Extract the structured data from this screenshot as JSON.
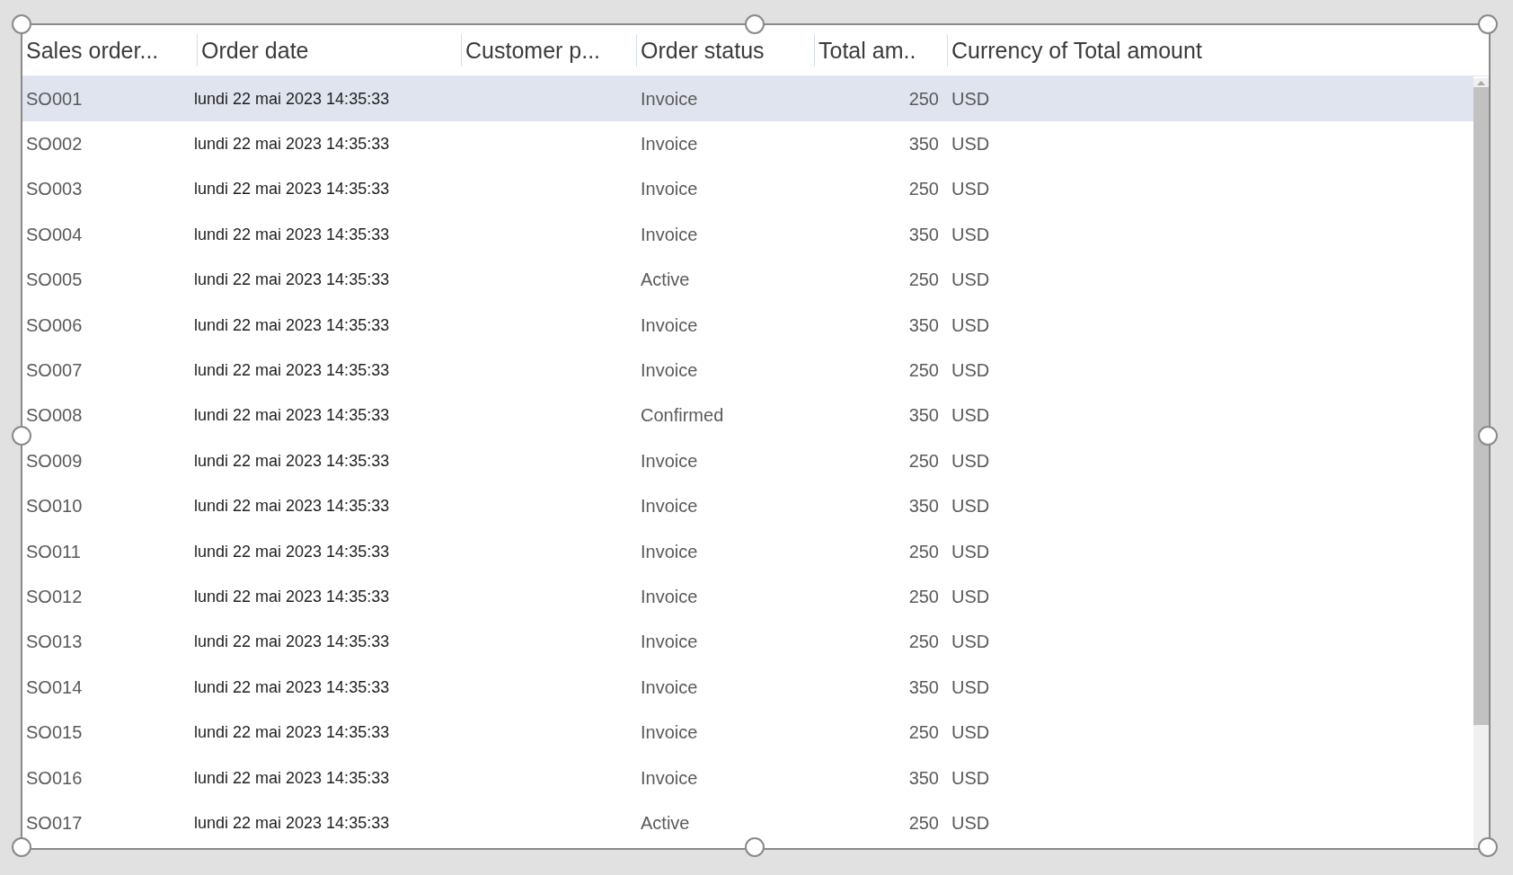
{
  "table": {
    "columns": [
      "Sales order...",
      "Order date",
      "Customer p...",
      "Order status",
      "Total am..",
      "Currency of Total amount"
    ],
    "rows": [
      {
        "order": "SO001",
        "date": "lundi 22 mai 2023 14:35:33",
        "status": "Invoice",
        "total": "250",
        "currency": "USD",
        "selected": true
      },
      {
        "order": "SO002",
        "date": "lundi 22 mai 2023 14:35:33",
        "status": "Invoice",
        "total": "350",
        "currency": "USD",
        "selected": false
      },
      {
        "order": "SO003",
        "date": "lundi 22 mai 2023 14:35:33",
        "status": "Invoice",
        "total": "250",
        "currency": "USD",
        "selected": false
      },
      {
        "order": "SO004",
        "date": "lundi 22 mai 2023 14:35:33",
        "status": "Invoice",
        "total": "350",
        "currency": "USD",
        "selected": false
      },
      {
        "order": "SO005",
        "date": "lundi 22 mai 2023 14:35:33",
        "status": "Active",
        "total": "250",
        "currency": "USD",
        "selected": false
      },
      {
        "order": "SO006",
        "date": "lundi 22 mai 2023 14:35:33",
        "status": "Invoice",
        "total": "350",
        "currency": "USD",
        "selected": false
      },
      {
        "order": "SO007",
        "date": "lundi 22 mai 2023 14:35:33",
        "status": "Invoice",
        "total": "250",
        "currency": "USD",
        "selected": false
      },
      {
        "order": "SO008",
        "date": "lundi 22 mai 2023 14:35:33",
        "status": "Confirmed",
        "total": "350",
        "currency": "USD",
        "selected": false
      },
      {
        "order": "SO009",
        "date": "lundi 22 mai 2023 14:35:33",
        "status": "Invoice",
        "total": "250",
        "currency": "USD",
        "selected": false
      },
      {
        "order": "SO010",
        "date": "lundi 22 mai 2023 14:35:33",
        "status": "Invoice",
        "total": "350",
        "currency": "USD",
        "selected": false
      },
      {
        "order": "SO011",
        "date": "lundi 22 mai 2023 14:35:33",
        "status": "Invoice",
        "total": "250",
        "currency": "USD",
        "selected": false
      },
      {
        "order": "SO012",
        "date": "lundi 22 mai 2023 14:35:33",
        "status": "Invoice",
        "total": "250",
        "currency": "USD",
        "selected": false
      },
      {
        "order": "SO013",
        "date": "lundi 22 mai 2023 14:35:33",
        "status": "Invoice",
        "total": "250",
        "currency": "USD",
        "selected": false
      },
      {
        "order": "SO014",
        "date": "lundi 22 mai 2023 14:35:33",
        "status": "Invoice",
        "total": "350",
        "currency": "USD",
        "selected": false
      },
      {
        "order": "SO015",
        "date": "lundi 22 mai 2023 14:35:33",
        "status": "Invoice",
        "total": "250",
        "currency": "USD",
        "selected": false
      },
      {
        "order": "SO016",
        "date": "lundi 22 mai 2023 14:35:33",
        "status": "Invoice",
        "total": "350",
        "currency": "USD",
        "selected": false
      },
      {
        "order": "SO017",
        "date": "lundi 22 mai 2023 14:35:33",
        "status": "Active",
        "total": "250",
        "currency": "USD",
        "selected": false
      }
    ]
  }
}
